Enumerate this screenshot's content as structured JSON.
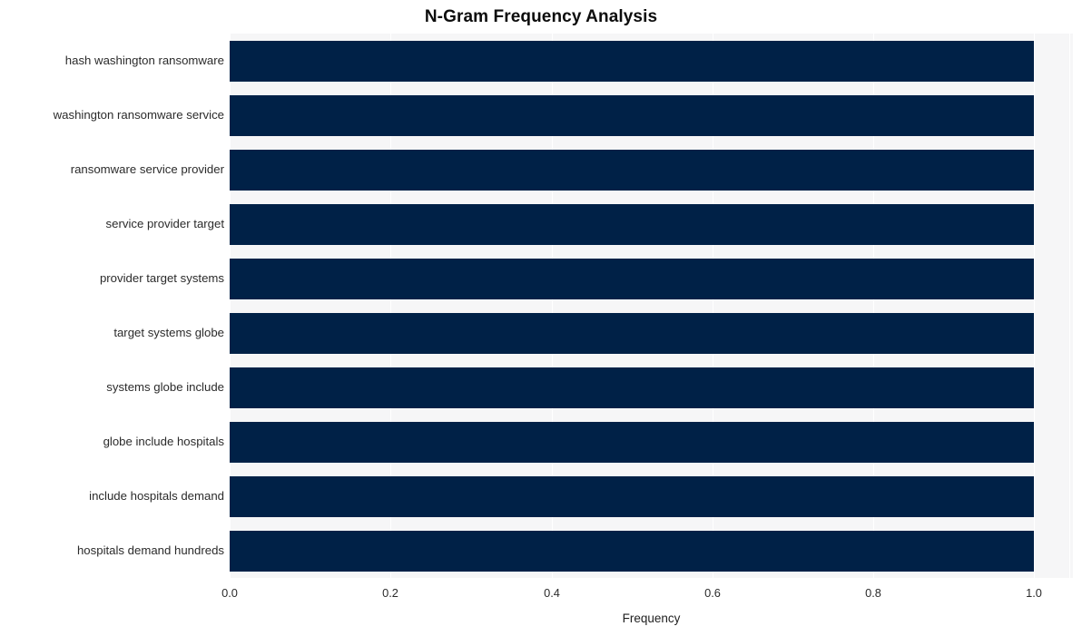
{
  "chart_data": {
    "type": "bar",
    "orientation": "horizontal",
    "title": "N-Gram Frequency Analysis",
    "xlabel": "Frequency",
    "ylabel": "",
    "categories": [
      "hash washington ransomware",
      "washington ransomware service",
      "ransomware service provider",
      "service provider target",
      "provider target systems",
      "target systems globe",
      "systems globe include",
      "globe include hospitals",
      "include hospitals demand",
      "hospitals demand hundreds"
    ],
    "values": [
      1.0,
      1.0,
      1.0,
      1.0,
      1.0,
      1.0,
      1.0,
      1.0,
      1.0,
      1.0
    ],
    "xlim": [
      0.0,
      1.048
    ],
    "xticks": [
      "0.0",
      "0.2",
      "0.4",
      "0.6",
      "0.8",
      "1.0"
    ],
    "xtick_values": [
      0.0,
      0.2,
      0.4,
      0.6,
      0.8,
      1.0
    ],
    "grid": "vertical-white",
    "legend": null,
    "bar_color": "#002147",
    "plot_background": "#f6f6f7",
    "figure_background": "#ffffff"
  },
  "style": {
    "title_color": "#0d0d0d",
    "tick_color": "#2b2b2b",
    "gridline_color": "#ffffff"
  }
}
